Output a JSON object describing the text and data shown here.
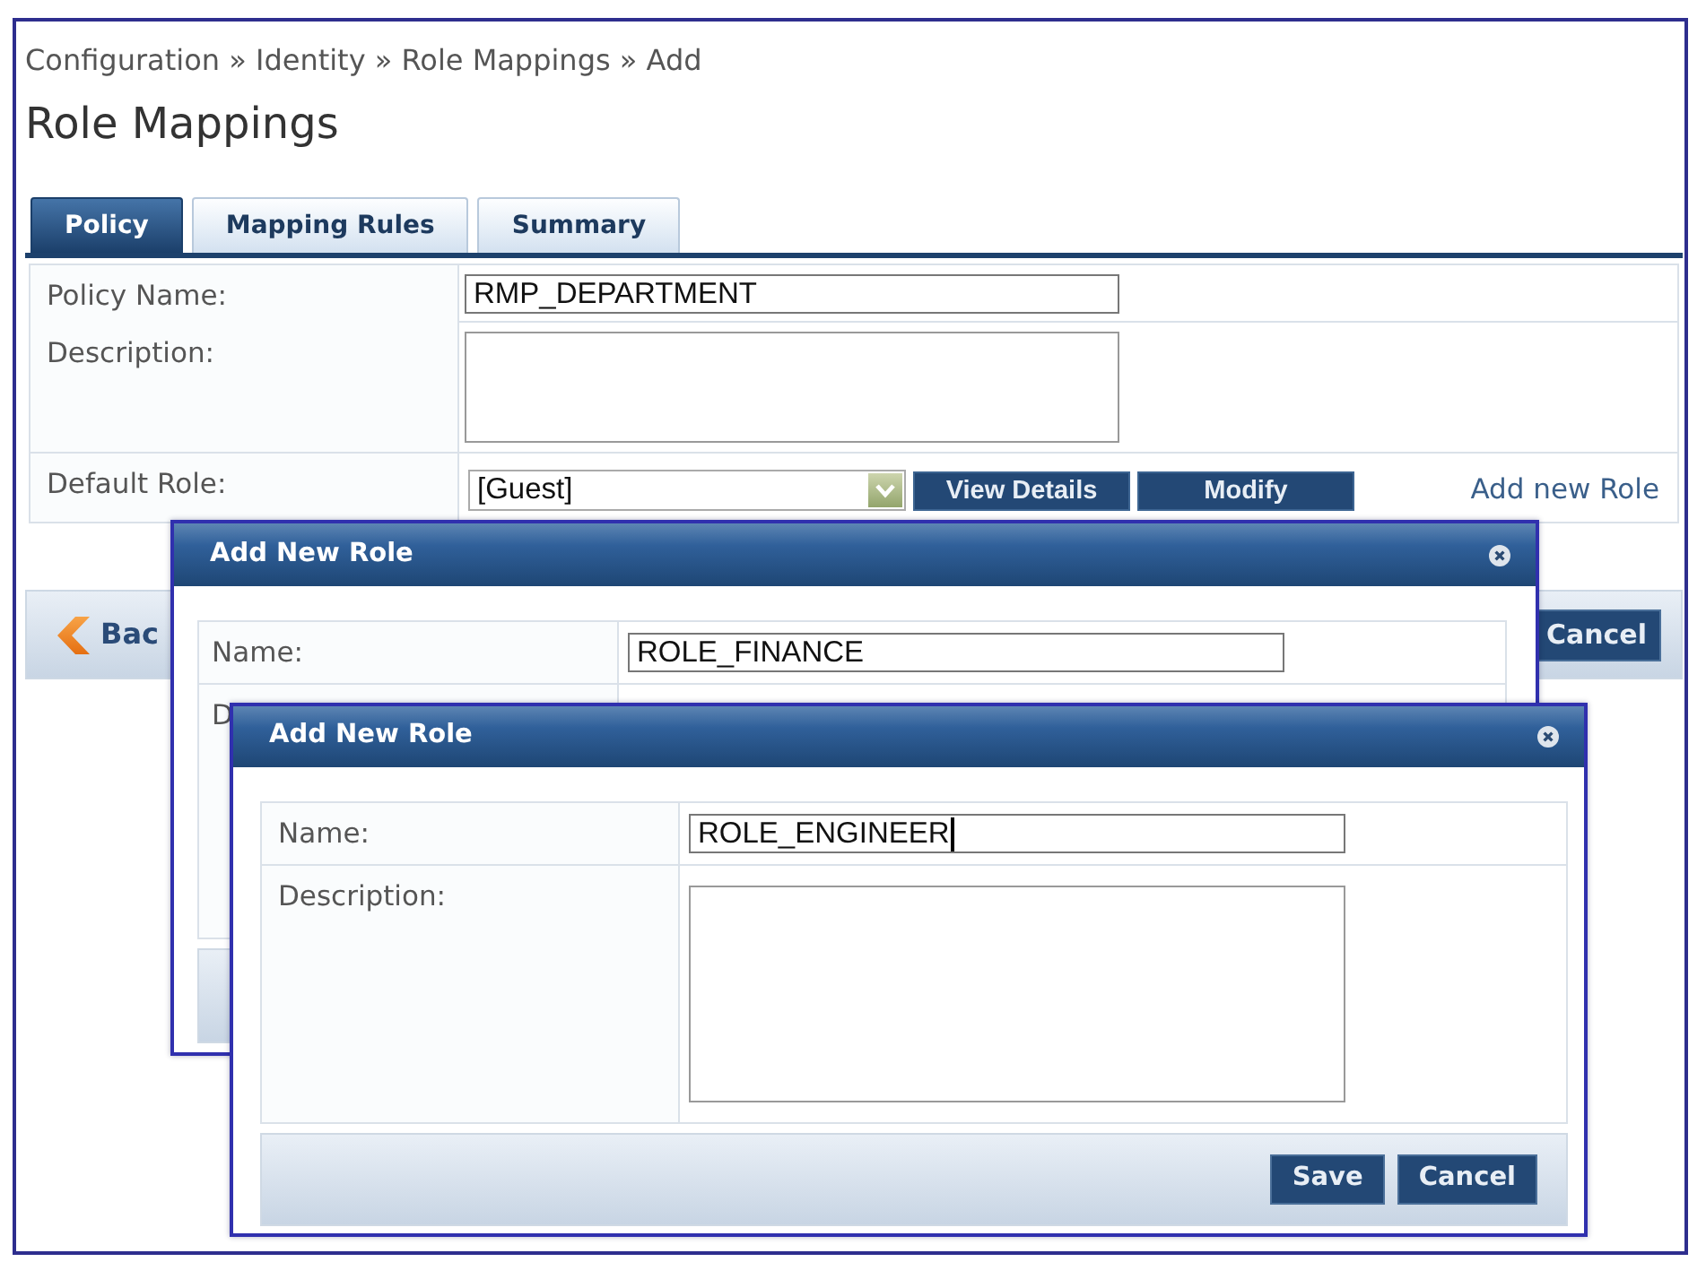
{
  "breadcrumb": "Configuration » Identity » Role Mappings » Add",
  "page_title": "Role Mappings",
  "tabs": [
    {
      "label": "Policy",
      "selected": true
    },
    {
      "label": "Mapping Rules",
      "selected": false
    },
    {
      "label": "Summary",
      "selected": false
    }
  ],
  "form": {
    "rows": [
      {
        "kind": "input",
        "label": "Policy Name:",
        "value": "RMP_DEPARTMENT",
        "focused": false
      },
      {
        "kind": "textarea",
        "label": "Description:"
      },
      {
        "kind": "select",
        "label": "Default Role:",
        "value": "[Guest]",
        "buttons": [
          "View Details",
          "Modify"
        ],
        "link": "Add new Role"
      }
    ]
  },
  "actions": {
    "back": "Bac",
    "cancel": "Cancel"
  },
  "dialogs": [
    {
      "title": "Add New Role",
      "rows": [
        {
          "kind": "input",
          "label": "Name:",
          "value": "ROLE_FINANCE",
          "focused": false
        },
        {
          "kind": "label",
          "label": "D"
        }
      ]
    },
    {
      "title": "Add New Role",
      "rows": [
        {
          "kind": "input",
          "label": "Name:",
          "value": "ROLE_ENGINEER",
          "focused": true
        },
        {
          "kind": "textarea",
          "label": "Description:"
        }
      ],
      "buttons": [
        "Save",
        "Cancel"
      ]
    }
  ]
}
